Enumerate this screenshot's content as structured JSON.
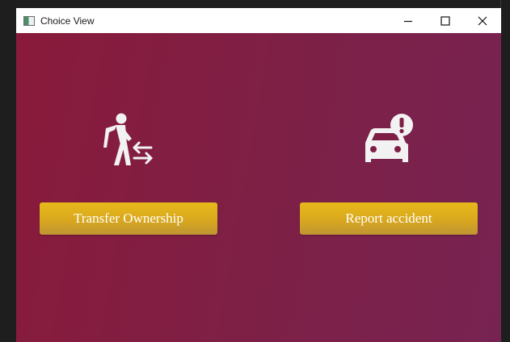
{
  "window": {
    "title": "Choice View",
    "controls": {
      "minimize": "minimize-icon",
      "maximize": "maximize-icon",
      "close": "close-icon"
    }
  },
  "actions": [
    {
      "label": "Transfer Ownership",
      "icon": "person-transfer-icon"
    },
    {
      "label": "Report accident",
      "icon": "car-alert-icon"
    }
  ],
  "colors": {
    "background_start": "#891a3b",
    "background_end": "#772352",
    "button_top": "#e7b91a",
    "button_bottom": "#bf9533",
    "icon": "#f2f2f2"
  }
}
